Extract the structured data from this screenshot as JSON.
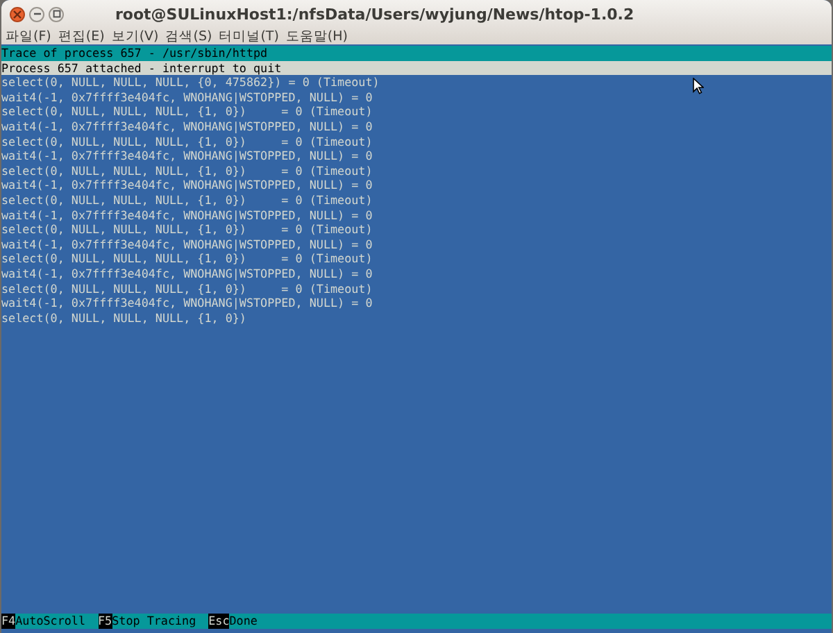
{
  "window": {
    "title": "root@SULinuxHost1:/nfsData/Users/wyjung/News/htop-1.0.2"
  },
  "menu": [
    "파일(F)",
    "편집(E)",
    "보기(V)",
    "검색(S)",
    "터미널(T)",
    "도움말(H)"
  ],
  "trace_header": "Trace of process 657 - /usr/sbin/httpd",
  "status_line": "Process 657 attached - interrupt to quit",
  "lines": [
    "select(0, NULL, NULL, NULL, {0, 475862}) = 0 (Timeout)",
    "wait4(-1, 0x7ffff3e404fc, WNOHANG|WSTOPPED, NULL) = 0",
    "select(0, NULL, NULL, NULL, {1, 0})     = 0 (Timeout)",
    "wait4(-1, 0x7ffff3e404fc, WNOHANG|WSTOPPED, NULL) = 0",
    "select(0, NULL, NULL, NULL, {1, 0})     = 0 (Timeout)",
    "wait4(-1, 0x7ffff3e404fc, WNOHANG|WSTOPPED, NULL) = 0",
    "select(0, NULL, NULL, NULL, {1, 0})     = 0 (Timeout)",
    "wait4(-1, 0x7ffff3e404fc, WNOHANG|WSTOPPED, NULL) = 0",
    "select(0, NULL, NULL, NULL, {1, 0})     = 0 (Timeout)",
    "wait4(-1, 0x7ffff3e404fc, WNOHANG|WSTOPPED, NULL) = 0",
    "select(0, NULL, NULL, NULL, {1, 0})     = 0 (Timeout)",
    "wait4(-1, 0x7ffff3e404fc, WNOHANG|WSTOPPED, NULL) = 0",
    "select(0, NULL, NULL, NULL, {1, 0})     = 0 (Timeout)",
    "wait4(-1, 0x7ffff3e404fc, WNOHANG|WSTOPPED, NULL) = 0",
    "select(0, NULL, NULL, NULL, {1, 0})     = 0 (Timeout)",
    "wait4(-1, 0x7ffff3e404fc, WNOHANG|WSTOPPED, NULL) = 0",
    "select(0, NULL, NULL, NULL, {1, 0})"
  ],
  "function_keys": [
    {
      "key": "F4",
      "label": "AutoScroll"
    },
    {
      "key": "F5",
      "label": "Stop Tracing"
    },
    {
      "key": "Esc",
      "label": "Done"
    }
  ]
}
